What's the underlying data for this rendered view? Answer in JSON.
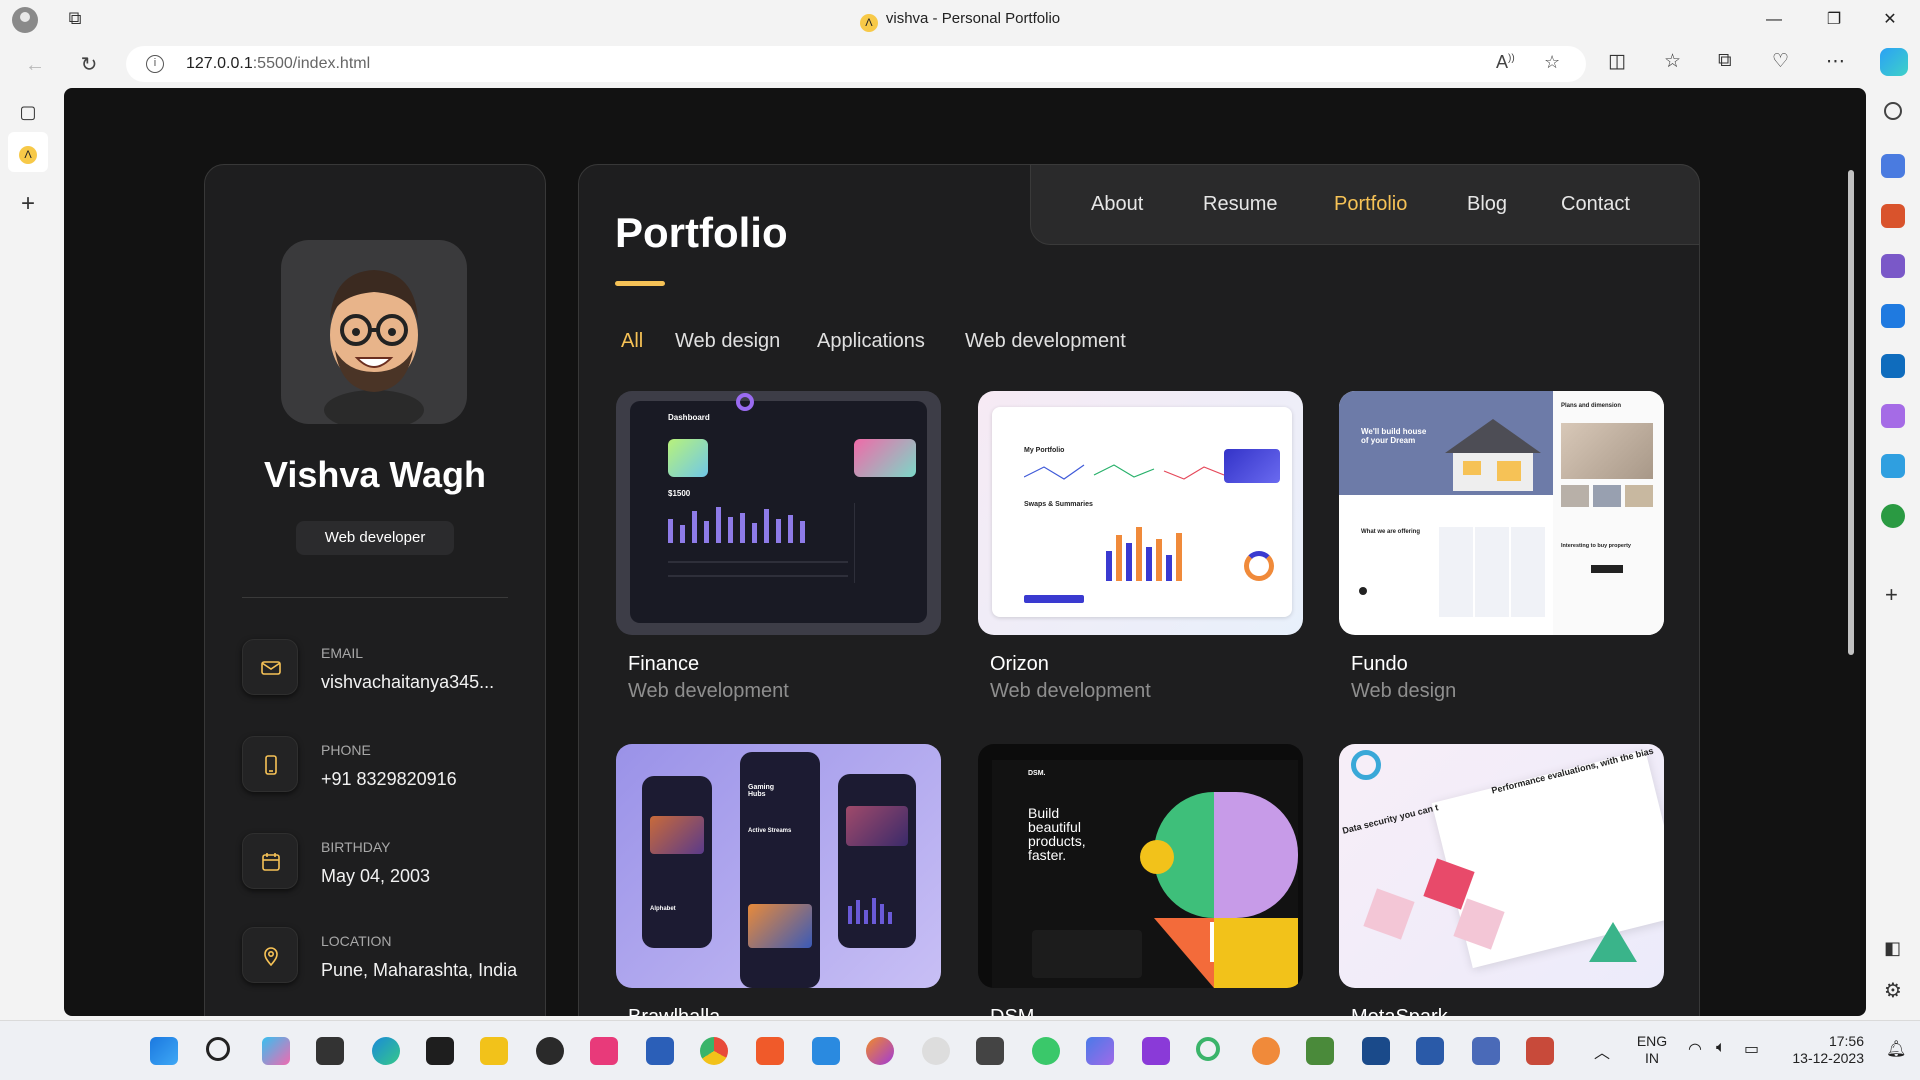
{
  "browser": {
    "window_title": "vishva - Personal Portfolio",
    "favicon_letter": "Λ",
    "url_host": "127.0.0.1",
    "url_rest": ":5500/index.html"
  },
  "sidebar": {
    "name": "Vishva Wagh",
    "role": "Web developer",
    "contacts": [
      {
        "label": "Email",
        "value": "vishvachaitanya345...",
        "icon": "mail-icon"
      },
      {
        "label": "Phone",
        "value": "+91 8329820916",
        "icon": "phone-icon"
      },
      {
        "label": "Birthday",
        "value": "May 04, 2003",
        "icon": "calendar-icon"
      },
      {
        "label": "Location",
        "value": "Pune, Maharashta, India",
        "icon": "location-pin-icon"
      }
    ]
  },
  "navbar": {
    "items": [
      "About",
      "Resume",
      "Portfolio",
      "Blog",
      "Contact"
    ],
    "active": "Portfolio"
  },
  "portfolio": {
    "title": "Portfolio",
    "filters": [
      "All",
      "Web design",
      "Applications",
      "Web development"
    ],
    "active_filter": "All",
    "projects": [
      {
        "title": "Finance",
        "category": "Web development"
      },
      {
        "title": "Orizon",
        "category": "Web development"
      },
      {
        "title": "Fundo",
        "category": "Web design"
      },
      {
        "title": "Brawlhalla",
        "category": ""
      },
      {
        "title": "DSM.",
        "category": ""
      },
      {
        "title": "MetaSpark",
        "category": ""
      }
    ],
    "thumb_text": {
      "finance_heading": "Dashboard",
      "finance_amount": "$1500",
      "orizon_heading": "My Portfolio",
      "orizon_sub": "Swaps & Summaries",
      "fundo_hero": "We'll build house of your Dream",
      "fundo_side": "Plans and dimension",
      "fundo_offer": "What we are offering",
      "fundo_buy": "Interesting to buy property",
      "brawl_hub": "Gaming Hubs",
      "brawl_streams": "Active Streams",
      "brawl_alpha": "Alphabet",
      "dsm_logo": "DSM.",
      "dsm_hero": "Build beautiful products, faster.",
      "meta_perf": "Performance evaluations, with the bias",
      "meta_data": "Data security you can t"
    }
  },
  "taskbar": {
    "lang": "ENG",
    "region": "IN",
    "time": "17:56",
    "date": "13-12-2023"
  }
}
